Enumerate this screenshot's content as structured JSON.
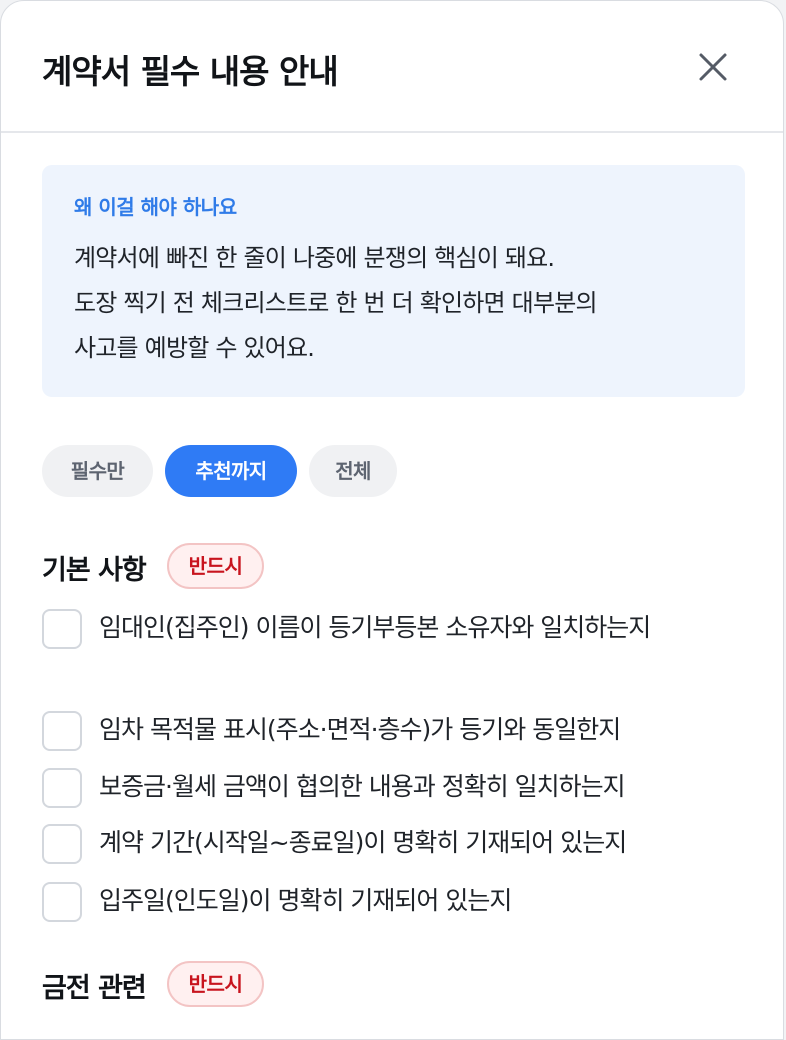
{
  "dialog": {
    "title": "계약서 필수 내용 안내",
    "close_label": "닫기"
  },
  "info": {
    "heading": "왜 이걸 해야 하나요",
    "lines": [
      "계약서에 빠진 한 줄이 나중에 분쟁의 핵심이 돼요.",
      "도장 찍기 전 체크리스트로 한 번 더 확인하면 대부분의",
      "사고를 예방할 수 있어요."
    ]
  },
  "filters": [
    {
      "label": "필수만",
      "selected": false
    },
    {
      "label": "추천까지",
      "selected": true
    },
    {
      "label": "전체",
      "selected": false
    }
  ],
  "sections": [
    {
      "title": "기본 사항",
      "badge": "반드시",
      "items": [
        {
          "label": "임대인(집주인) 이름이 등기부등본 소유자와 일치하는지",
          "checked": false
        },
        {
          "label": "임차 목적물 표시(주소·면적·층수)가 등기와 동일한지",
          "checked": false
        },
        {
          "label": "보증금·월세 금액이 협의한 내용과 정확히 일치하는지",
          "checked": false
        },
        {
          "label": "계약 기간(시작일~종료일)이 명확히 기재되어 있는지",
          "checked": false
        },
        {
          "label": "입주일(인도일)이 명확히 기재되어 있는지",
          "checked": false
        }
      ]
    },
    {
      "title": "금전 관련",
      "badge": "반드시",
      "items": []
    }
  ],
  "colors": {
    "accent": "#2f7bf5",
    "badge_text": "#c8141e",
    "badge_bg": "#fff0f0",
    "info_bg": "#eef4fd",
    "info_heading": "#2f7be8"
  }
}
